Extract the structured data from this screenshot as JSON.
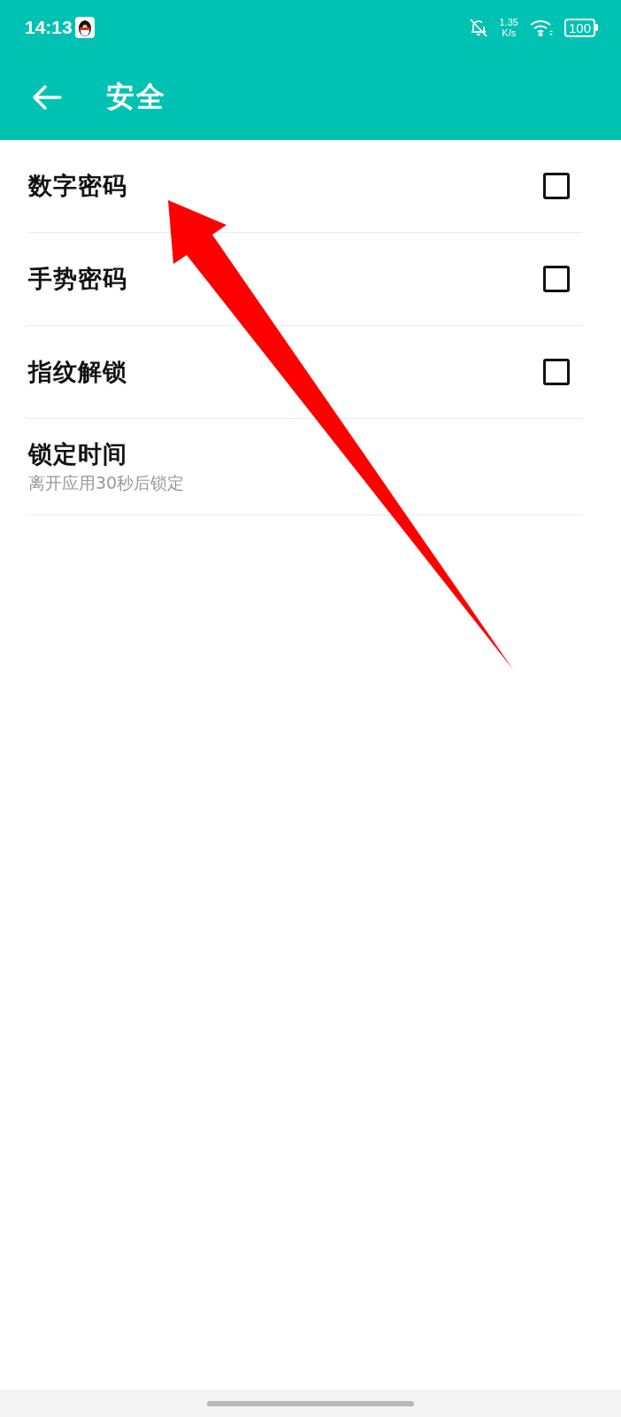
{
  "status_bar": {
    "time": "14:13",
    "speed": "1.35",
    "speed_unit": "K/s",
    "battery": "100"
  },
  "app_bar": {
    "title": "安全"
  },
  "settings": [
    {
      "kind": "checkbox",
      "label": "数字密码",
      "checked": false
    },
    {
      "kind": "checkbox",
      "label": "手势密码",
      "checked": false
    },
    {
      "kind": "checkbox",
      "label": "指纹解锁",
      "checked": false
    },
    {
      "kind": "value",
      "label": "锁定时间",
      "summary": "离开应用30秒后锁定"
    }
  ]
}
